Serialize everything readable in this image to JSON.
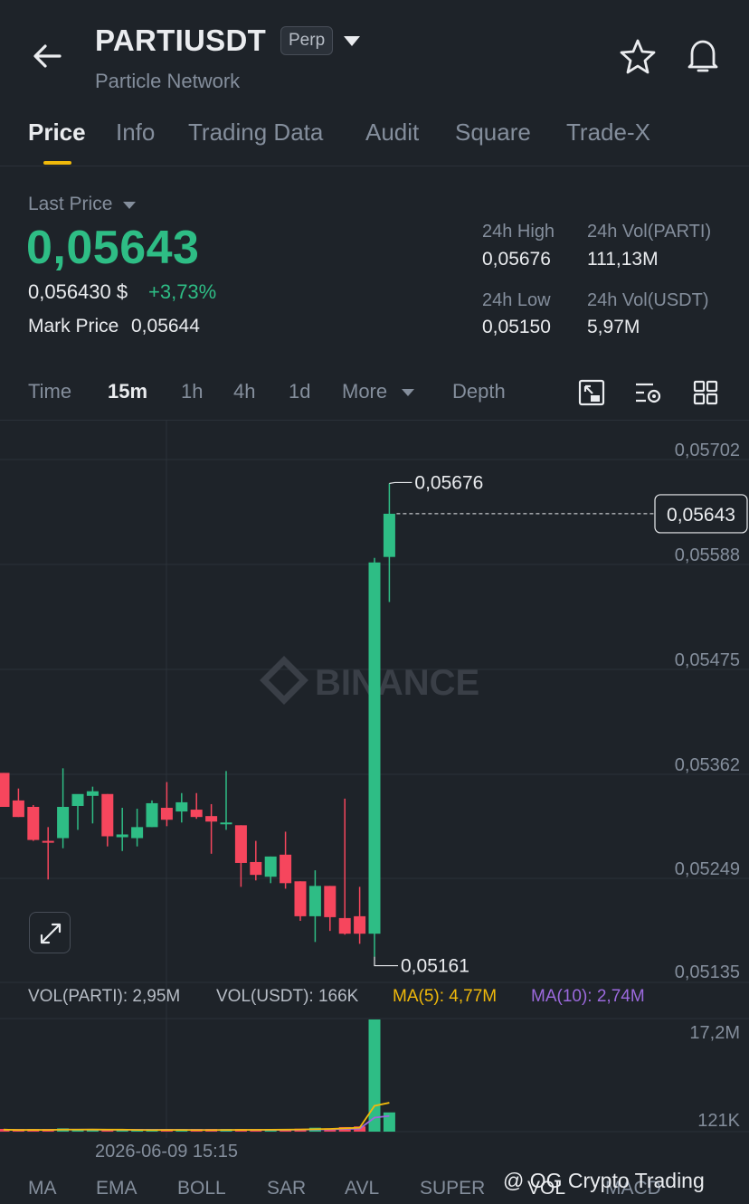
{
  "header": {
    "symbol": "PARTIUSDT",
    "badge": "Perp",
    "name": "Particle Network",
    "icons": [
      "back-arrow-icon",
      "dropdown-caret-icon",
      "star-icon",
      "bell-icon"
    ]
  },
  "tabs": [
    {
      "label": "Price",
      "active": true
    },
    {
      "label": "Info"
    },
    {
      "label": "Trading Data"
    },
    {
      "label": "Audit"
    },
    {
      "label": "Square"
    },
    {
      "label": "Trade-X"
    }
  ],
  "price": {
    "last_price_label": "Last Price",
    "last_price": "0,05643",
    "usd_price": "0,056430 $",
    "change": "+3,73%",
    "mark_price_label": "Mark Price",
    "mark_price": "0,05644"
  },
  "stats": {
    "high_label": "24h High",
    "high": "0,05676",
    "vol_parti_label": "24h Vol(PARTI)",
    "vol_parti": "111,13M",
    "low_label": "24h Low",
    "low": "0,05150",
    "vol_usdt_label": "24h Vol(USDT)",
    "vol_usdt": "5,97M"
  },
  "timeframes": {
    "items": [
      "Time",
      "15m",
      "1h",
      "4h",
      "1d",
      "More",
      "Depth"
    ],
    "active": "15m",
    "tools": [
      "fullscreen-icon",
      "chart-settings-icon",
      "grid-layout-icon"
    ]
  },
  "chart_data": {
    "type": "candlestick",
    "y_ticks": [
      "0,05702",
      "0,05588",
      "0,05475",
      "0,05362",
      "0,05249",
      "0,05135"
    ],
    "current_price_label": "0,05643",
    "high_marker": "0,05676",
    "low_marker": "0,05161",
    "x_label": "2026-06-09 15:15",
    "watermark": "BINANCE",
    "candles": [
      {
        "o": 0.05361,
        "h": 0.05361,
        "l": 0.05324,
        "c": 0.05324
      },
      {
        "o": 0.05331,
        "h": 0.05344,
        "l": 0.05313,
        "c": 0.05313
      },
      {
        "o": 0.05324,
        "h": 0.05326,
        "l": 0.05287,
        "c": 0.05288
      },
      {
        "o": 0.05287,
        "h": 0.05302,
        "l": 0.05245,
        "c": 0.05285
      },
      {
        "o": 0.0529,
        "h": 0.05366,
        "l": 0.05279,
        "c": 0.05324
      },
      {
        "o": 0.05325,
        "h": 0.05336,
        "l": 0.05299,
        "c": 0.05338
      },
      {
        "o": 0.05336,
        "h": 0.05346,
        "l": 0.05306,
        "c": 0.05341
      },
      {
        "o": 0.05338,
        "h": 0.05338,
        "l": 0.05281,
        "c": 0.05292
      },
      {
        "o": 0.05291,
        "h": 0.05323,
        "l": 0.05276,
        "c": 0.05294
      },
      {
        "o": 0.0529,
        "h": 0.05322,
        "l": 0.05281,
        "c": 0.05302
      },
      {
        "o": 0.05302,
        "h": 0.05331,
        "l": 0.05302,
        "c": 0.05328
      },
      {
        "o": 0.05323,
        "h": 0.05351,
        "l": 0.05303,
        "c": 0.0531
      },
      {
        "o": 0.05319,
        "h": 0.05339,
        "l": 0.05307,
        "c": 0.05329
      },
      {
        "o": 0.05321,
        "h": 0.05339,
        "l": 0.05311,
        "c": 0.05313
      },
      {
        "o": 0.05314,
        "h": 0.05327,
        "l": 0.05273,
        "c": 0.05308
      },
      {
        "o": 0.05307,
        "h": 0.05363,
        "l": 0.05299,
        "c": 0.05307
      },
      {
        "o": 0.05304,
        "h": 0.05304,
        "l": 0.05237,
        "c": 0.05263
      },
      {
        "o": 0.05264,
        "h": 0.05287,
        "l": 0.05244,
        "c": 0.0525
      },
      {
        "o": 0.05248,
        "h": 0.0527,
        "l": 0.05241,
        "c": 0.0527
      },
      {
        "o": 0.05272,
        "h": 0.05297,
        "l": 0.05235,
        "c": 0.05241
      },
      {
        "o": 0.05243,
        "h": 0.05243,
        "l": 0.052,
        "c": 0.05205
      },
      {
        "o": 0.05205,
        "h": 0.05255,
        "l": 0.05177,
        "c": 0.05238
      },
      {
        "o": 0.05238,
        "h": 0.05238,
        "l": 0.05189,
        "c": 0.05204
      },
      {
        "o": 0.05203,
        "h": 0.05333,
        "l": 0.05185,
        "c": 0.05186
      },
      {
        "o": 0.05205,
        "h": 0.05237,
        "l": 0.05175,
        "c": 0.05186
      },
      {
        "o": 0.05186,
        "h": 0.05595,
        "l": 0.05161,
        "c": 0.0559
      },
      {
        "o": 0.05596,
        "h": 0.05676,
        "l": 0.05547,
        "c": 0.05643
      }
    ],
    "volume": {
      "legend": [
        {
          "label": "VOL(PARTI): 2,95M",
          "color": "#b7bdc6"
        },
        {
          "label": "VOL(USDT): 166K",
          "color": "#b7bdc6"
        },
        {
          "label": "MA(5): 4,77M",
          "color": "#f0b90b"
        },
        {
          "label": "MA(10): 2,74M",
          "color": "#9c6ade"
        }
      ],
      "y_ticks": [
        "17,2M",
        "121K"
      ],
      "values": [
        0.3,
        0.2,
        0.3,
        0.25,
        0.5,
        0.3,
        0.25,
        0.2,
        0.3,
        0.25,
        0.2,
        0.3,
        0.25,
        0.2,
        0.25,
        0.3,
        0.35,
        0.3,
        0.25,
        0.3,
        0.45,
        0.6,
        0.5,
        0.7,
        0.8,
        17.2,
        2.95
      ]
    }
  },
  "bottom_tabs": [
    "MA",
    "EMA",
    "BOLL",
    "SAR",
    "AVL",
    "SUPER",
    "VOL",
    "MACD"
  ],
  "watermark": "@ OG Crypto Trading",
  "colors": {
    "up": "#2ebd85",
    "down": "#f6465d",
    "accent": "#f0b90b",
    "bg": "#1e2329"
  }
}
